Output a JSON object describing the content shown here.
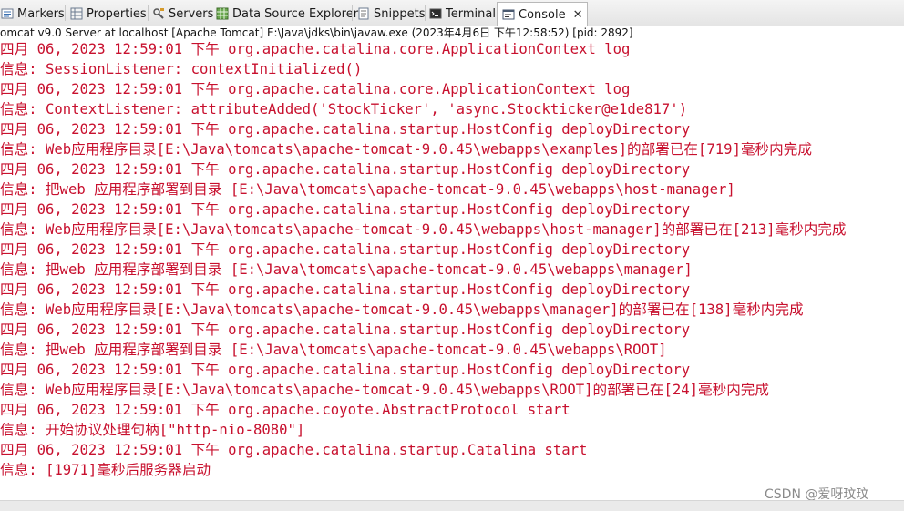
{
  "tabs": [
    {
      "label": "Markers",
      "icon": "markers-icon"
    },
    {
      "label": "Properties",
      "icon": "properties-icon"
    },
    {
      "label": "Servers",
      "icon": "servers-icon"
    },
    {
      "label": "Data Source Explorer",
      "icon": "data-source-explorer-icon"
    },
    {
      "label": "Snippets",
      "icon": "snippets-icon"
    },
    {
      "label": "Terminal",
      "icon": "terminal-icon"
    },
    {
      "label": "Console",
      "icon": "console-icon",
      "active": true,
      "close": "✕"
    }
  ],
  "status_line": "omcat v9.0 Server at localhost [Apache Tomcat] E:\\Java\\jdks\\bin\\javaw.exe  (2023年4月6日 下午12:58:52) [pid: 2892]",
  "log_color": "#c8102e",
  "console_lines": [
    "四月 06, 2023 12:59:01 下午 org.apache.catalina.core.ApplicationContext log",
    "信息: SessionListener: contextInitialized()",
    "四月 06, 2023 12:59:01 下午 org.apache.catalina.core.ApplicationContext log",
    "信息: ContextListener: attributeAdded('StockTicker', 'async.Stockticker@e1de817')",
    "四月 06, 2023 12:59:01 下午 org.apache.catalina.startup.HostConfig deployDirectory",
    "信息: Web应用程序目录[E:\\Java\\tomcats\\apache-tomcat-9.0.45\\webapps\\examples]的部署已在[719]毫秒内完成",
    "四月 06, 2023 12:59:01 下午 org.apache.catalina.startup.HostConfig deployDirectory",
    "信息: 把web 应用程序部署到目录 [E:\\Java\\tomcats\\apache-tomcat-9.0.45\\webapps\\host-manager]",
    "四月 06, 2023 12:59:01 下午 org.apache.catalina.startup.HostConfig deployDirectory",
    "信息: Web应用程序目录[E:\\Java\\tomcats\\apache-tomcat-9.0.45\\webapps\\host-manager]的部署已在[213]毫秒内完成",
    "四月 06, 2023 12:59:01 下午 org.apache.catalina.startup.HostConfig deployDirectory",
    "信息: 把web 应用程序部署到目录 [E:\\Java\\tomcats\\apache-tomcat-9.0.45\\webapps\\manager]",
    "四月 06, 2023 12:59:01 下午 org.apache.catalina.startup.HostConfig deployDirectory",
    "信息: Web应用程序目录[E:\\Java\\tomcats\\apache-tomcat-9.0.45\\webapps\\manager]的部署已在[138]毫秒内完成",
    "四月 06, 2023 12:59:01 下午 org.apache.catalina.startup.HostConfig deployDirectory",
    "信息: 把web 应用程序部署到目录 [E:\\Java\\tomcats\\apache-tomcat-9.0.45\\webapps\\ROOT]",
    "四月 06, 2023 12:59:01 下午 org.apache.catalina.startup.HostConfig deployDirectory",
    "信息: Web应用程序目录[E:\\Java\\tomcats\\apache-tomcat-9.0.45\\webapps\\ROOT]的部署已在[24]毫秒内完成",
    "四月 06, 2023 12:59:01 下午 org.apache.coyote.AbstractProtocol start",
    "信息: 开始协议处理句柄[\"http-nio-8080\"]",
    "四月 06, 2023 12:59:01 下午 org.apache.catalina.startup.Catalina start",
    "信息: [1971]毫秒后服务器启动"
  ],
  "watermark": "CSDN @爱呀玟玟"
}
